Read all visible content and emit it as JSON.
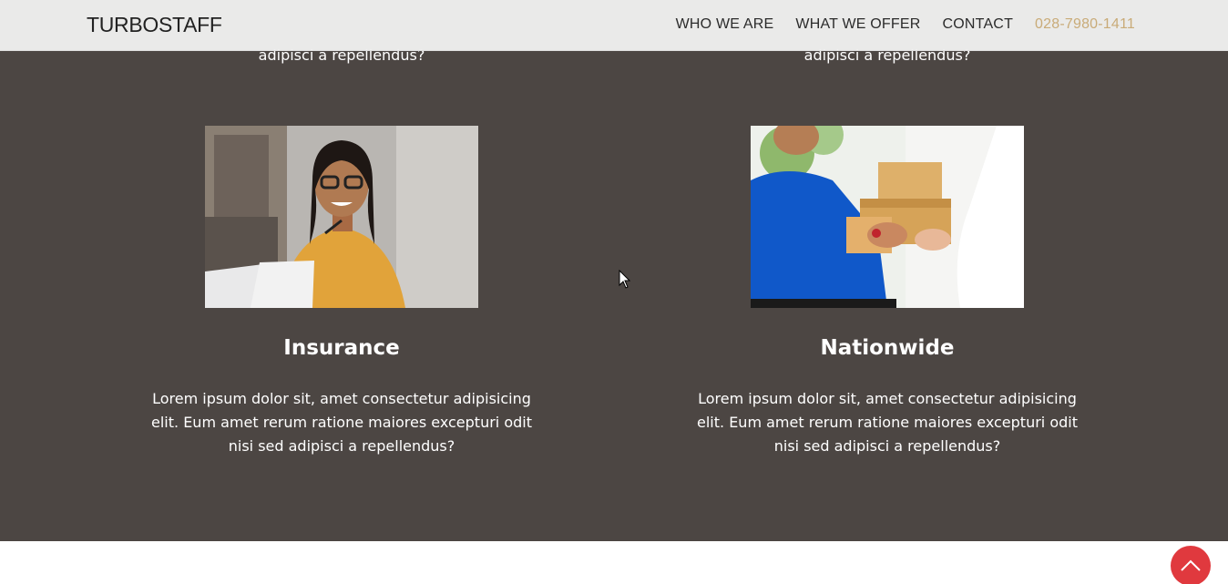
{
  "nav": {
    "logo": "TURBOSTAFF",
    "links": [
      "WHO WE ARE",
      "WHAT WE OFFER",
      "CONTACT"
    ],
    "phone": "028-7980-1411"
  },
  "top_partial": {
    "left_text": "adipisci a repellendus?",
    "right_text": "adipisci a repellendus?"
  },
  "cards": [
    {
      "title": "Insurance",
      "text": "Lorem ipsum dolor sit, amet consectetur adipisicing elit. Eum amet rerum ratione maiores excepturi odit nisi sed adipisci a repellendus?",
      "image": "woman-with-headset-at-laptop"
    },
    {
      "title": "Nationwide",
      "text": "Lorem ipsum dolor sit, amet consectetur adipisicing elit. Eum amet rerum ratione maiores excepturi odit nisi sed adipisci a repellendus?",
      "image": "courier-delivering-packages"
    }
  ],
  "colors": {
    "section_bg": "#4c4643",
    "phone_accent": "#c9ab78",
    "scroll_button": "#e0393e"
  },
  "icons": {
    "scroll_top": "chevron-up-icon",
    "cursor": "mouse-pointer-icon"
  }
}
